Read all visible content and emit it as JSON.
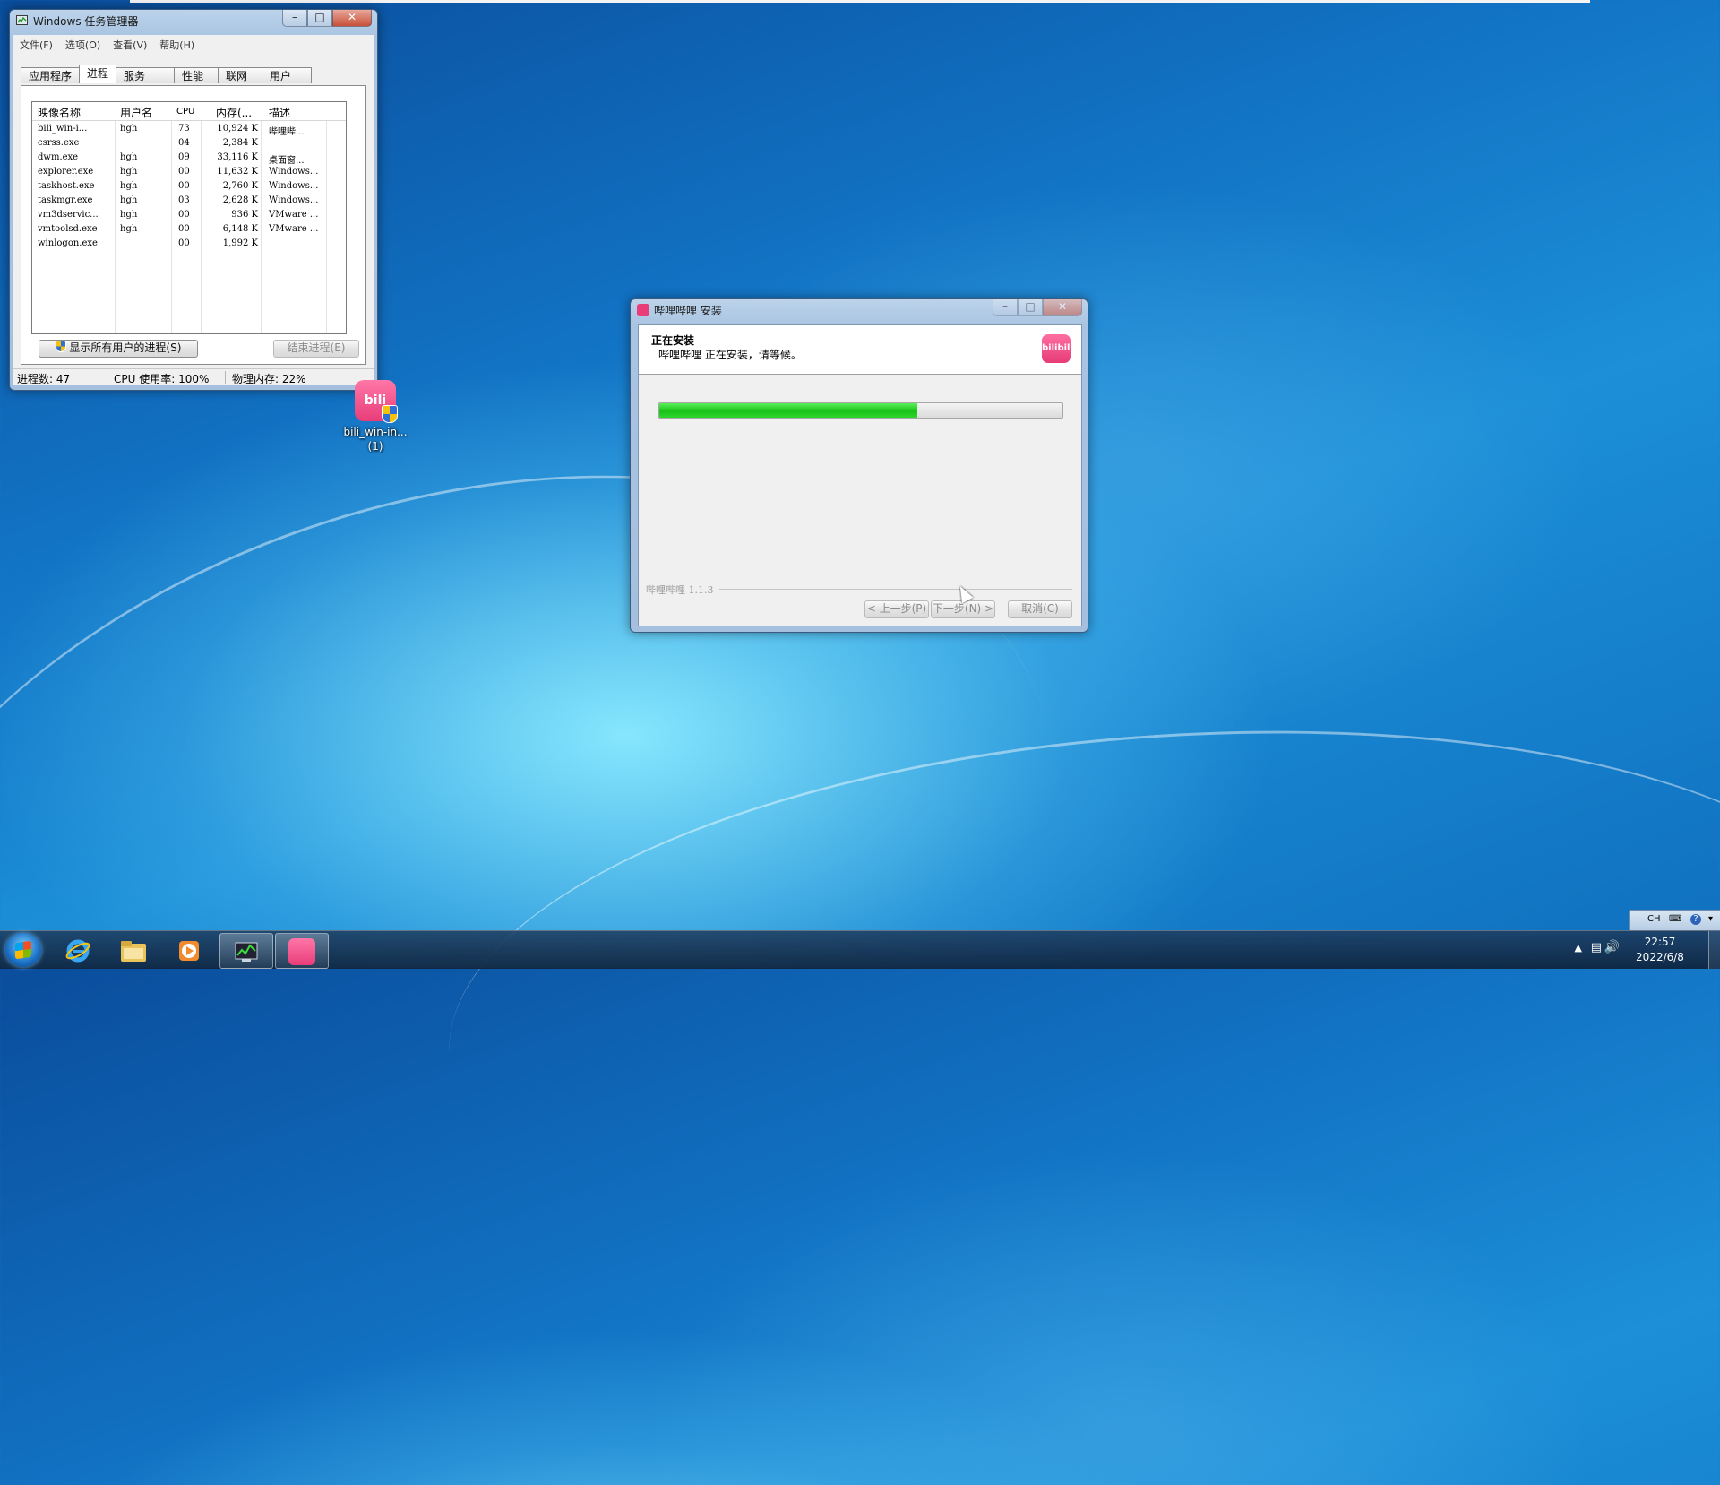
{
  "task_manager": {
    "title": "Windows 任务管理器",
    "menu": [
      "文件(F)",
      "选项(O)",
      "查看(V)",
      "帮助(H)"
    ],
    "tabs": [
      "应用程序",
      "进程",
      "服务",
      "性能",
      "联网",
      "用户"
    ],
    "active_tab": "进程",
    "columns": [
      "映像名称",
      "用户名",
      "CPU",
      "内存(...",
      "描述"
    ],
    "processes": [
      {
        "name": "bili_win-i...",
        "user": "hgh",
        "cpu": "73",
        "mem": "10,924 K",
        "desc": "哔哩哔..."
      },
      {
        "name": "csrss.exe",
        "user": "",
        "cpu": "04",
        "mem": "2,384 K",
        "desc": ""
      },
      {
        "name": "dwm.exe",
        "user": "hgh",
        "cpu": "09",
        "mem": "33,116 K",
        "desc": "桌面窗..."
      },
      {
        "name": "explorer.exe",
        "user": "hgh",
        "cpu": "00",
        "mem": "11,632 K",
        "desc": "Windows..."
      },
      {
        "name": "taskhost.exe",
        "user": "hgh",
        "cpu": "00",
        "mem": "2,760 K",
        "desc": "Windows..."
      },
      {
        "name": "taskmgr.exe",
        "user": "hgh",
        "cpu": "03",
        "mem": "2,628 K",
        "desc": "Windows..."
      },
      {
        "name": "vm3dservic...",
        "user": "hgh",
        "cpu": "00",
        "mem": "936 K",
        "desc": "VMware ..."
      },
      {
        "name": "vmtoolsd.exe",
        "user": "hgh",
        "cpu": "00",
        "mem": "6,148 K",
        "desc": "VMware ..."
      },
      {
        "name": "winlogon.exe",
        "user": "",
        "cpu": "00",
        "mem": "1,992 K",
        "desc": ""
      }
    ],
    "show_all_button": "显示所有用户的进程(S)",
    "end_process_button": "结束进程(E)",
    "status": {
      "process_count": "进程数: 47",
      "cpu_usage": "CPU 使用率: 100%",
      "physical_memory": "物理内存: 22%"
    }
  },
  "desktop_icon": {
    "label_line1": "bili_win-in...",
    "label_line2": "(1)",
    "tile_text": "bili"
  },
  "installer": {
    "title": "哔哩哔哩 安装",
    "heading": "正在安装",
    "subheading": "哔哩哔哩 正在安装，请等候。",
    "logo_text": "bilibili",
    "progress": 0.64,
    "brand": "哔哩哔哩 1.1.3",
    "back_button": "< 上一步(P)",
    "next_button": "下一步(N) >",
    "cancel_button": "取消(C)"
  },
  "taskbar": {
    "clock_time": "22:57",
    "clock_date": "2022/6/8",
    "lang": "CH"
  },
  "colors": {
    "progress_fill": "#18c218",
    "bili_pink": "#e83d79",
    "taskbar": "#1e3c5f"
  },
  "icons": [
    "start-orb-icon",
    "ie-icon",
    "explorer-folder-icon",
    "media-player-icon",
    "task-manager-icon",
    "bilibili-icon",
    "network-icon",
    "volume-icon",
    "help-icon",
    "shield-icon"
  ]
}
